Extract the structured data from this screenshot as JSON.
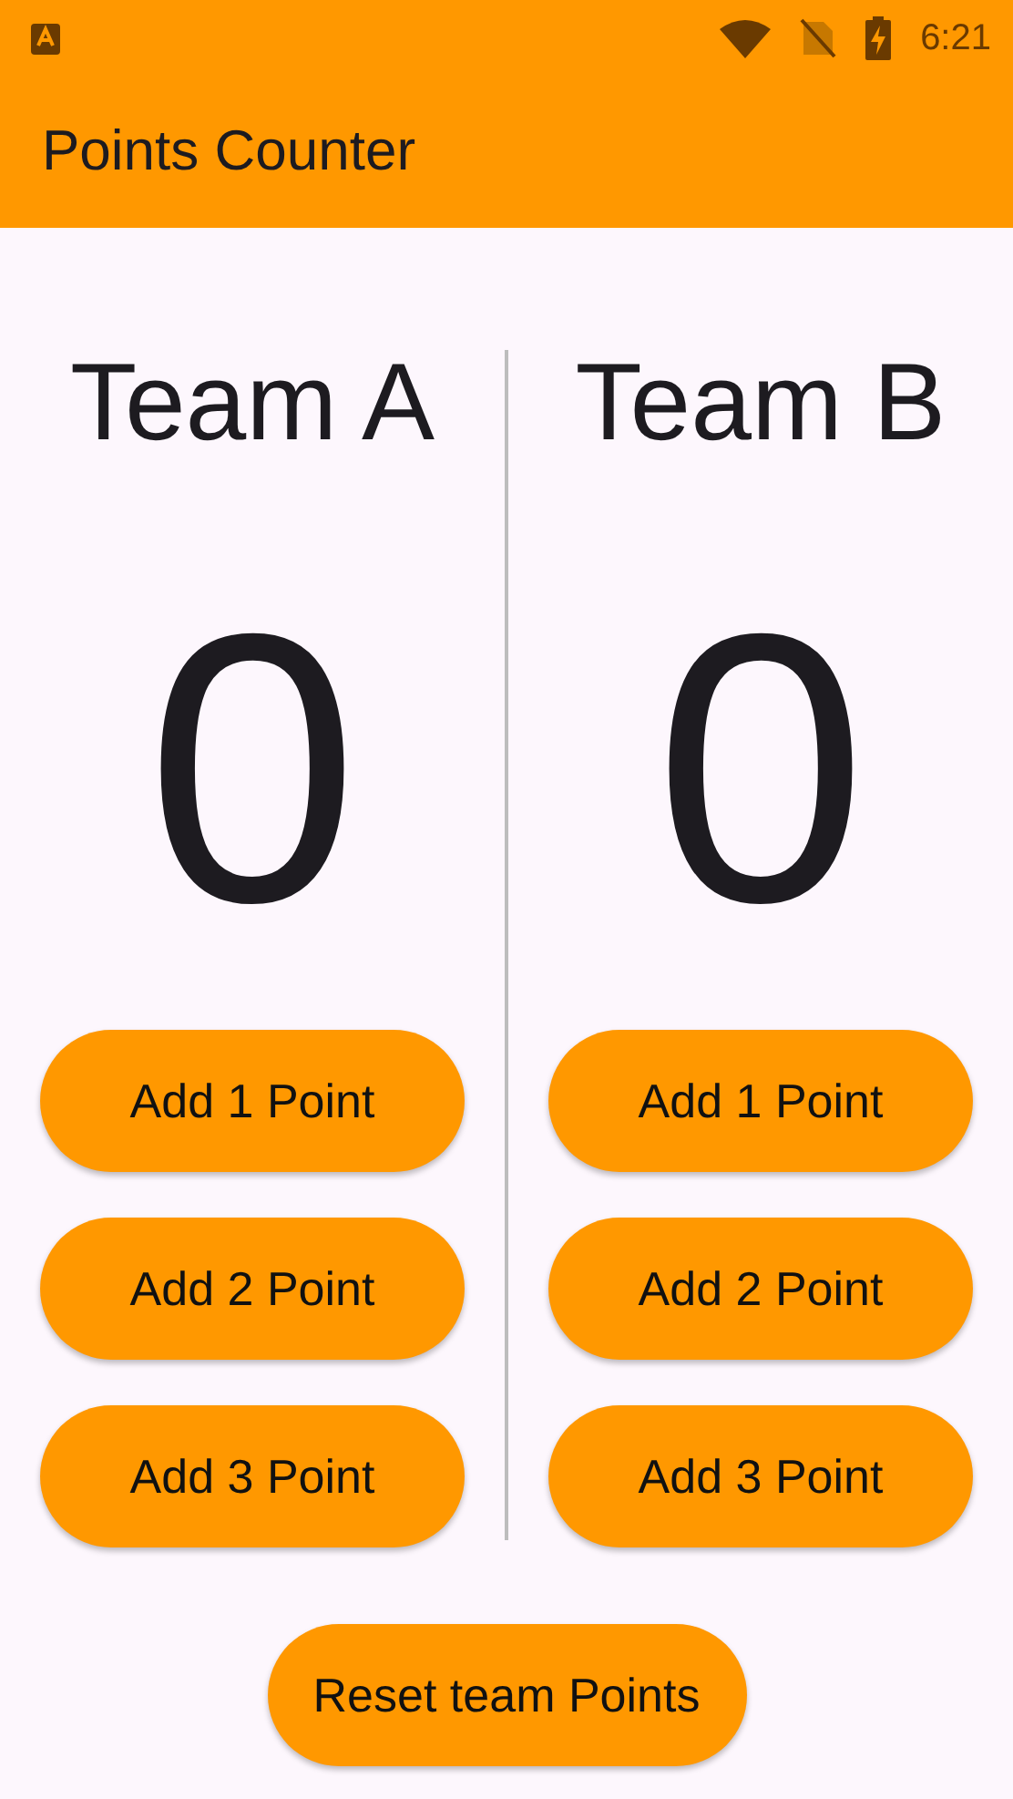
{
  "status_bar": {
    "time": "6:21"
  },
  "app_bar": {
    "title": "Points Counter"
  },
  "teams": [
    {
      "name": "Team A",
      "score": "0",
      "buttons": [
        "Add 1 Point",
        "Add 2 Point",
        "Add 3 Point"
      ]
    },
    {
      "name": "Team B",
      "score": "0",
      "buttons": [
        "Add 1 Point",
        "Add 2 Point",
        "Add 3 Point"
      ]
    }
  ],
  "reset_button": "Reset team Points"
}
